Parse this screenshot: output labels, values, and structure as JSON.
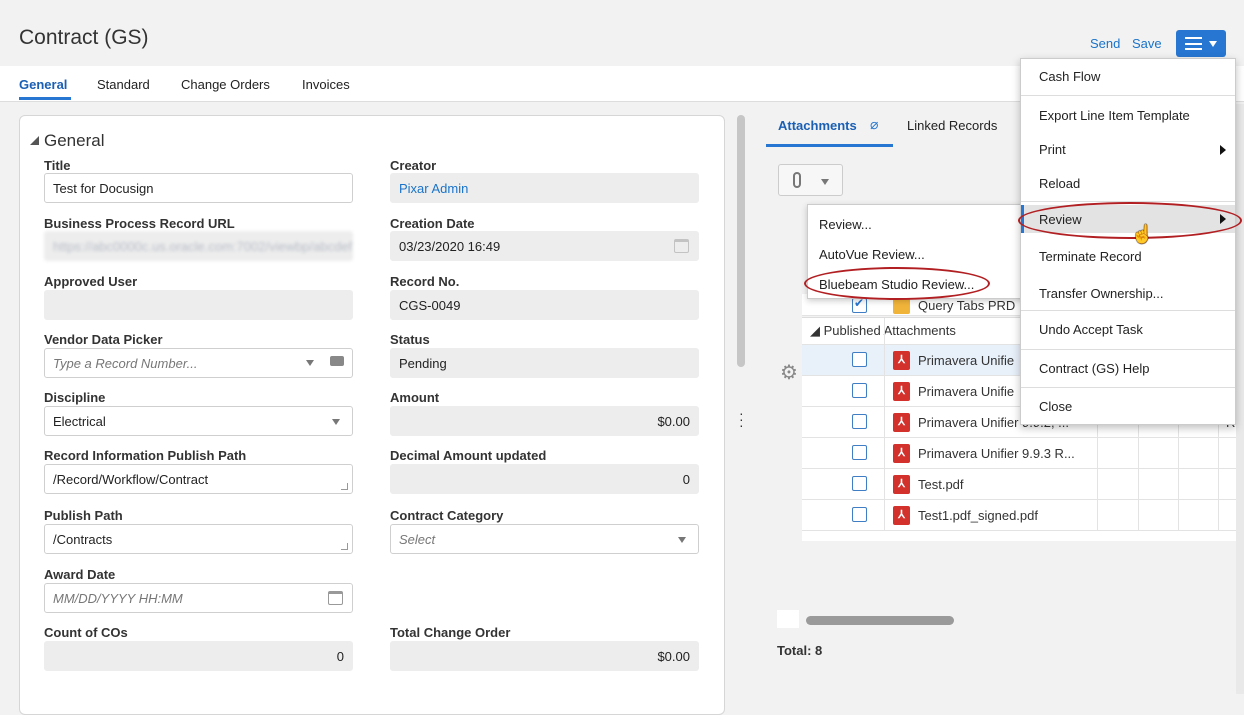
{
  "header": {
    "title": "Contract (GS)",
    "send_label": "Send",
    "save_label": "Save"
  },
  "tabs": [
    "General",
    "Standard",
    "Change Orders",
    "Invoices"
  ],
  "section": {
    "title": "General"
  },
  "fields": {
    "title": {
      "label": "Title",
      "value": "Test for Docusign"
    },
    "creator": {
      "label": "Creator",
      "value": "Pixar Admin"
    },
    "bp_url": {
      "label": "Business Process Record URL",
      "value": "https://abc0000c.us.oracle.com:7002/viewbp/abcdefg"
    },
    "creation_date": {
      "label": "Creation Date",
      "value": "03/23/2020 16:49"
    },
    "approved_user": {
      "label": "Approved User",
      "value": ""
    },
    "record_no": {
      "label": "Record No.",
      "value": "CGS-0049"
    },
    "vendor": {
      "label": "Vendor Data Picker",
      "placeholder": "Type a Record Number..."
    },
    "status": {
      "label": "Status",
      "value": "Pending"
    },
    "discipline": {
      "label": "Discipline",
      "value": "Electrical"
    },
    "amount": {
      "label": "Amount",
      "value": "$0.00"
    },
    "publish_path_info": {
      "label": "Record Information Publish Path",
      "value": "/Record/Workflow/Contract"
    },
    "decimal_amount": {
      "label": "Decimal Amount updated",
      "value": "0"
    },
    "publish_path": {
      "label": "Publish Path",
      "value": "/Contracts"
    },
    "contract_category": {
      "label": "Contract Category",
      "placeholder": "Select"
    },
    "award_date": {
      "label": "Award Date",
      "placeholder": "MM/DD/YYYY HH:MM"
    },
    "count_cos": {
      "label": "Count of COs",
      "value": "0"
    },
    "total_change_order": {
      "label": "Total Change Order",
      "value": "$0.00"
    }
  },
  "right": {
    "tabs": [
      "Attachments",
      "Linked Records"
    ],
    "group_label": "Published Attachments",
    "files": [
      "Query Tabs PRD",
      "Primavera Unifie",
      "Primavera Unifie",
      "Primavera Unifier 9.9.2, ...",
      "Primavera Unifier 9.9.3 R...",
      "Test.pdf",
      "Test1.pdf_signed.pdf"
    ],
    "col_text": "Re",
    "total": "Total: 8"
  },
  "submenu": [
    "Review...",
    "AutoVue Review...",
    "Bluebeam Studio Review..."
  ],
  "menu": [
    "Cash Flow",
    "Export Line Item Template",
    "Print",
    "Reload",
    "Review",
    "Terminate Record",
    "Transfer Ownership...",
    "Undo Accept Task",
    "Contract (GS) Help",
    "Close"
  ],
  "colors": {
    "accent": "#2676d2",
    "highlight_ellipse": "#b21f22",
    "pdf_red": "#d2312c"
  }
}
